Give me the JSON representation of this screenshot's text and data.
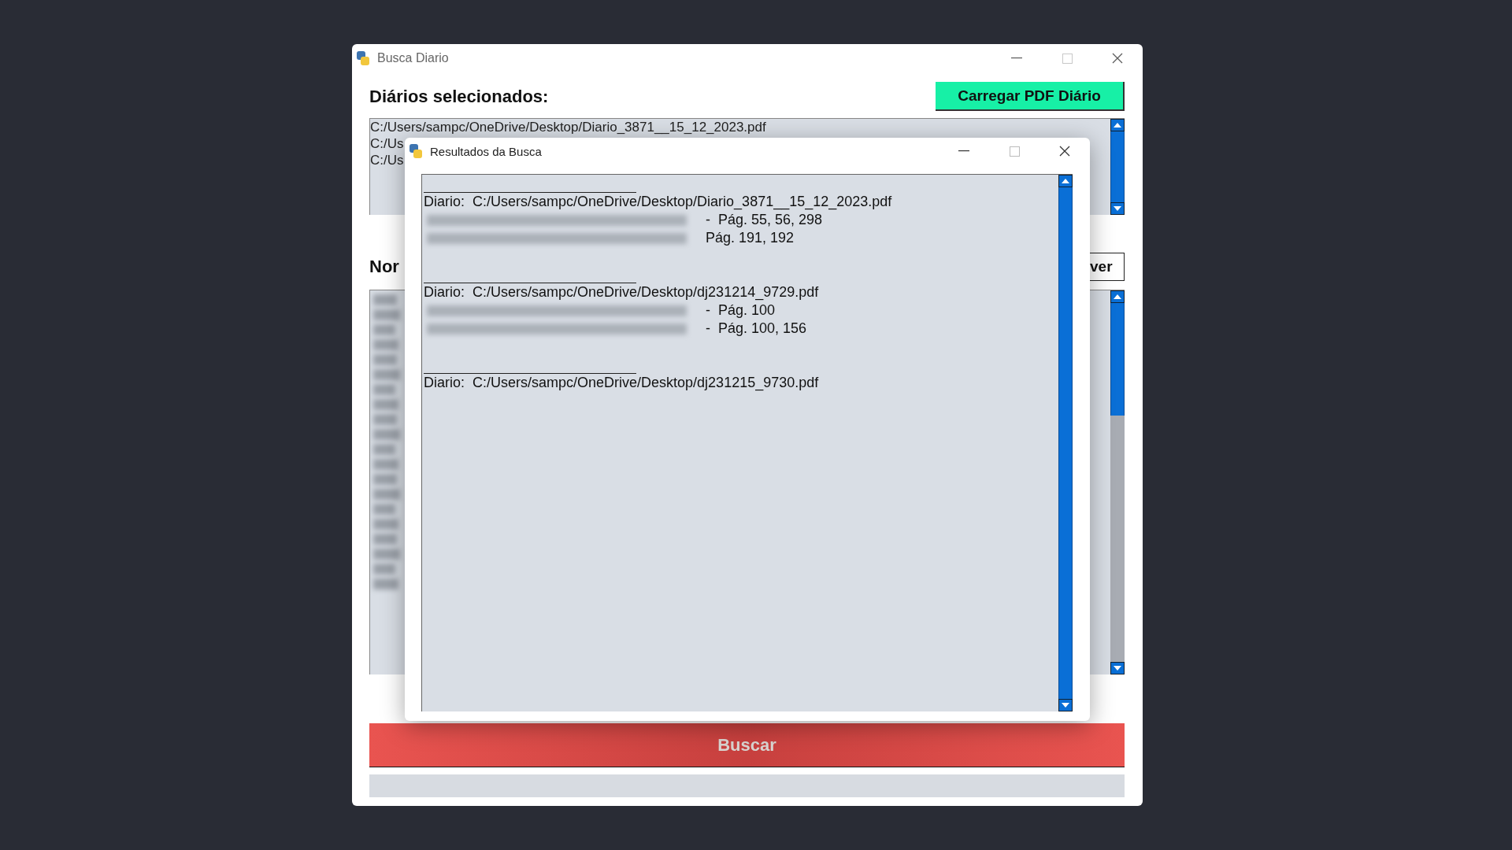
{
  "main_window": {
    "title": "Busca Diario"
  },
  "selected_section": {
    "label": "Diários selecionados:",
    "load_button": "Carregar PDF Diário",
    "files": [
      "C:/Users/sampc/OneDrive/Desktop/Diario_3871__15_12_2023.pdf",
      "C:/Us",
      "C:/Us"
    ]
  },
  "names_section": {
    "label": "Nor",
    "button": "ver"
  },
  "search_button": "Buscar",
  "progress": {
    "level": 0
  },
  "results_dialog": {
    "title": "Resultados da Busca",
    "results": [
      {
        "label": "Diario:",
        "path": "C:/Users/sampc/OneDrive/Desktop/Diario_3871__15_12_2023.pdf",
        "hits": [
          "-  Pág. 55, 56, 298",
          "Pág. 191, 192"
        ]
      },
      {
        "label": "Diario:",
        "path": "C:/Users/sampc/OneDrive/Desktop/dj231214_9729.pdf",
        "hits": [
          "-  Pág. 100",
          "-  Pág. 100, 156"
        ]
      },
      {
        "label": "Diario:",
        "path": "C:/Users/sampc/OneDrive/Desktop/dj231215_9730.pdf"
      }
    ]
  }
}
